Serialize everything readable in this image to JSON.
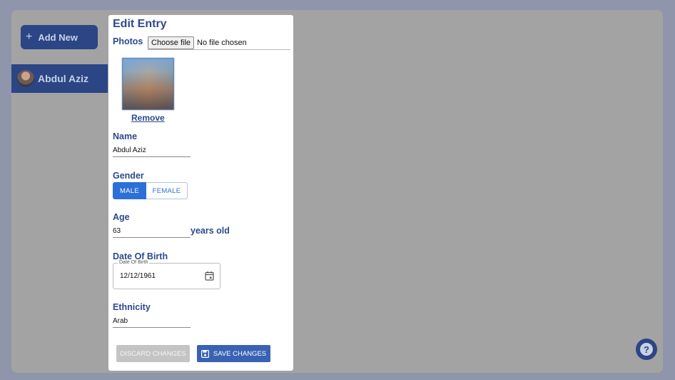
{
  "sidebar": {
    "add_new_label": "Add New",
    "plus_symbol": "+",
    "entries": [
      {
        "label": "Abdul Aziz"
      }
    ]
  },
  "panel": {
    "title": "Edit Entry",
    "photos": {
      "label": "Photos",
      "choose_file_label": "Choose file",
      "file_status": "No file chosen",
      "remove_label": "Remove"
    },
    "name": {
      "label": "Name",
      "value": "Abdul Aziz"
    },
    "gender": {
      "label": "Gender",
      "options": [
        "MALE",
        "FEMALE"
      ],
      "selected": "MALE"
    },
    "age": {
      "label": "Age",
      "value": "63",
      "unit": "years old"
    },
    "dob": {
      "label": "Date Of Birth",
      "legend": "Date Of Birth",
      "value": "12/12/1961"
    },
    "ethnicity": {
      "label": "Ethnicity",
      "value": "Arab"
    },
    "actions": {
      "discard_label": "DISCARD CHANGES",
      "save_label": "SAVE CHANGES"
    }
  },
  "help": {
    "symbol": "?"
  },
  "colors": {
    "brand": "#2b4585",
    "accent": "#2c6fd6",
    "save": "#3a62b3",
    "disabled": "#c4c4c4"
  }
}
